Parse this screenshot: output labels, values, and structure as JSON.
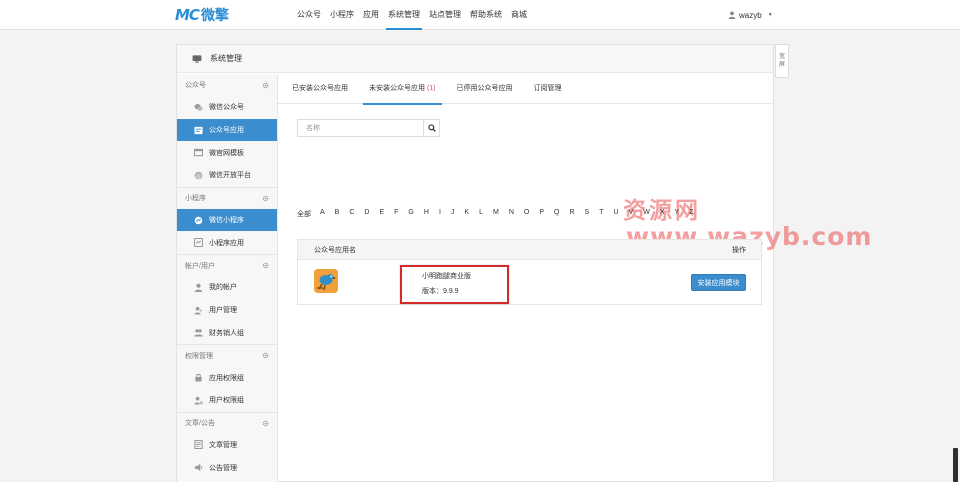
{
  "header": {
    "logo_mark": "MC",
    "logo_text": "微擎",
    "nav": [
      "公众号",
      "小程序",
      "应用",
      "系统管理",
      "站点管理",
      "帮助系统",
      "商城"
    ],
    "active_nav": "系统管理",
    "username": "wazyb"
  },
  "panel": {
    "title": "系统管理"
  },
  "sidebar": {
    "groups": [
      {
        "label": "公众号",
        "items": [
          {
            "label": "微信公众号",
            "icon": "wechat-icon"
          },
          {
            "label": "公众号应用",
            "icon": "app-icon"
          },
          {
            "label": "微官网模板",
            "icon": "template-icon"
          },
          {
            "label": "微信开放平台",
            "icon": "open-platform-icon"
          }
        ]
      },
      {
        "label": "小程序",
        "items": [
          {
            "label": "微信小程序",
            "icon": "miniapp-icon"
          },
          {
            "label": "小程序应用",
            "icon": "miniapp-app-icon"
          }
        ]
      },
      {
        "label": "帐户/用户",
        "items": [
          {
            "label": "我的帐户",
            "icon": "user-icon"
          },
          {
            "label": "用户管理",
            "icon": "users-icon"
          },
          {
            "label": "财务销人组",
            "icon": "group-icon"
          }
        ]
      },
      {
        "label": "权限管理",
        "items": [
          {
            "label": "应用权限组",
            "icon": "lock-icon"
          },
          {
            "label": "用户权限组",
            "icon": "user-lock-icon"
          }
        ]
      },
      {
        "label": "文章/公告",
        "items": [
          {
            "label": "文章管理",
            "icon": "article-icon"
          },
          {
            "label": "公告管理",
            "icon": "announcement-icon"
          }
        ]
      }
    ]
  },
  "tabs": [
    {
      "label": "已安装公众号应用",
      "count": ""
    },
    {
      "label": "未安装公众号应用",
      "count": "(1)"
    },
    {
      "label": "已停用公众号应用",
      "count": ""
    },
    {
      "label": "订阅管理",
      "count": ""
    }
  ],
  "search": {
    "placeholder": "名称"
  },
  "alphabet": [
    "全部",
    "A",
    "B",
    "C",
    "D",
    "E",
    "F",
    "G",
    "H",
    "I",
    "J",
    "K",
    "L",
    "M",
    "N",
    "O",
    "P",
    "Q",
    "R",
    "S",
    "T",
    "U",
    "V",
    "W",
    "X",
    "Y",
    "Z"
  ],
  "table": {
    "col_name": "公众号应用名",
    "col_action": "操作",
    "rows": [
      {
        "name": "小明跑腿商业版",
        "version": "版本：9.9.9",
        "action": "安装应用模块"
      }
    ]
  },
  "watermark": {
    "cn": "资源网",
    "url": "www.wazyb.com"
  },
  "right_tab": [
    "宽",
    "屏"
  ]
}
